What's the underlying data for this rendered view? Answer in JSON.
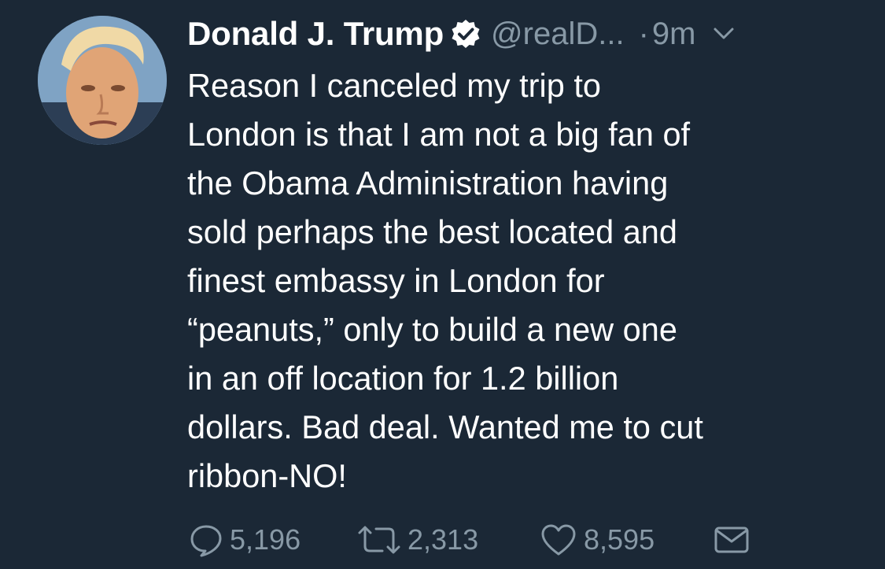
{
  "tweet": {
    "display_name": "Donald J. Trump",
    "handle": "@realD...",
    "separator": "·",
    "time": "9m",
    "text_lines": [
      "Reason I canceled my trip to",
      "London is that I am not a big fan of",
      "the Obama Administration having",
      "sold perhaps the best located and",
      "finest embassy in London for",
      "“peanuts,” only to build a new one",
      "in an off location for 1.2 billion",
      "dollars. Bad deal. Wanted me to cut",
      "ribbon-NO!"
    ]
  },
  "actions": {
    "reply_count": "5,196",
    "retweet_count": "2,313",
    "like_count": "8,595"
  },
  "icons": {
    "verified": "verified-badge-icon",
    "caret": "chevron-down-icon",
    "reply": "speech-bubble-icon",
    "retweet": "retweet-arrows-icon",
    "like": "heart-icon",
    "message": "envelope-icon"
  },
  "colors": {
    "background": "#1b2836",
    "text": "#ffffff",
    "secondary": "#8899a6",
    "verified_badge": "#ffffff"
  }
}
